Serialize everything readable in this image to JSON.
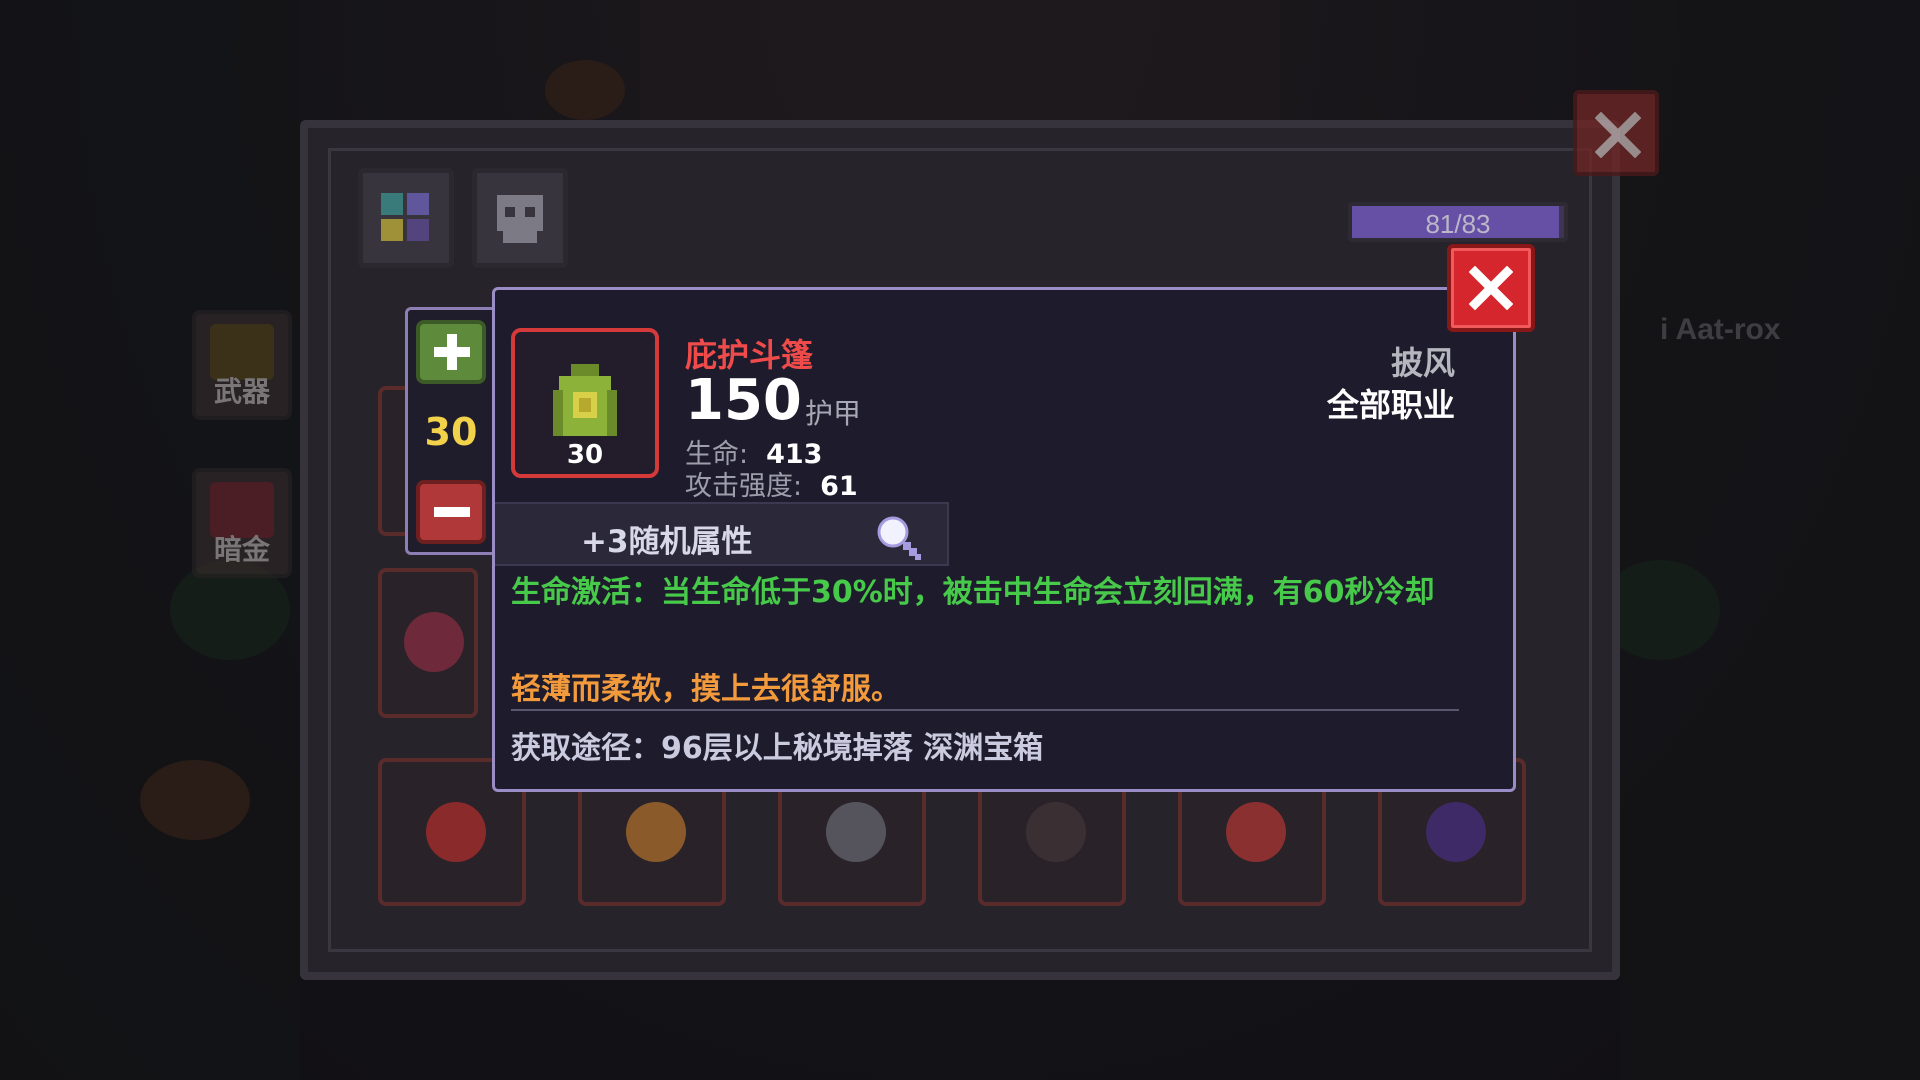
{
  "background": {
    "player_name_fragment": "i Aat-rox"
  },
  "side_menu": {
    "weapon_label": "武器",
    "gold_label": "暗金"
  },
  "inventory": {
    "capacity_text": "81/83",
    "capacity_fraction": 0.976,
    "tabs": [
      {
        "icon": "grid-tab-icon"
      },
      {
        "icon": "skull-tab-icon"
      }
    ]
  },
  "stepper": {
    "value": "30"
  },
  "item": {
    "name": "庇护斗篷",
    "level": "30",
    "armor_value": "150",
    "armor_label": "护甲",
    "stats": [
      {
        "label": "生命:",
        "value": "413"
      },
      {
        "label": "攻击强度:",
        "value": "61"
      }
    ],
    "type": "披风",
    "class_restriction": "全部职业",
    "random_attributes": "+3随机属性",
    "effect_text": "生命激活：当生命低于30%时，被击中生命会立刻回满，有60秒冷却",
    "flavor_text": "轻薄而柔软，摸上去很舒服。",
    "source_text": "获取途径：96层以上秘境掉落 深渊宝箱"
  },
  "colors": {
    "item_name": "#ef4b4b",
    "effect": "#47c94a",
    "flavor": "#f29a3c",
    "close_button": "#d4262c"
  }
}
